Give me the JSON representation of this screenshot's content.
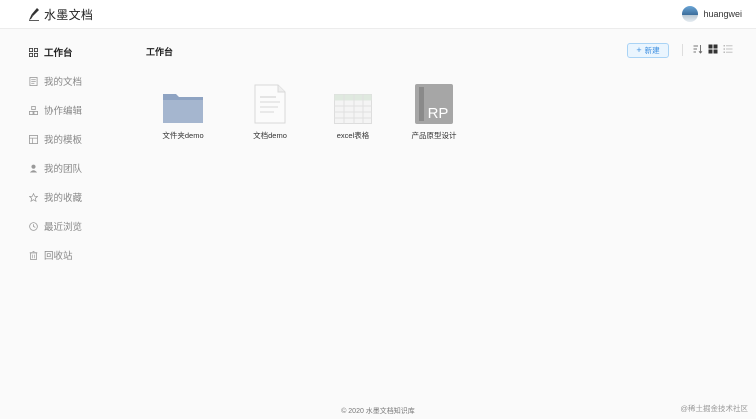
{
  "header": {
    "app_title": "水墨文档",
    "user_name": "huangwei"
  },
  "sidebar": {
    "items": [
      {
        "label": "工作台",
        "icon": "grid-icon",
        "active": true
      },
      {
        "label": "我的文档",
        "icon": "document-icon"
      },
      {
        "label": "协作编辑",
        "icon": "collaborate-icon"
      },
      {
        "label": "我的模板",
        "icon": "template-icon"
      },
      {
        "label": "我的团队",
        "icon": "team-icon"
      },
      {
        "label": "我的收藏",
        "icon": "star-icon"
      },
      {
        "label": "最近浏览",
        "icon": "clock-icon"
      },
      {
        "label": "回收站",
        "icon": "trash-icon"
      }
    ]
  },
  "main": {
    "title": "工作台",
    "new_button_label": "新建",
    "files": [
      {
        "label": "文件夹demo",
        "type": "folder"
      },
      {
        "label": "文档demo",
        "type": "document"
      },
      {
        "label": "excel表格",
        "type": "spreadsheet"
      },
      {
        "label": "产品原型设计",
        "type": "prototype",
        "badge": "RP"
      }
    ]
  },
  "footer": {
    "copyright": "© 2020 水墨文档知识库",
    "watermark": "@稀土掘金技术社区"
  },
  "colors": {
    "accent": "#3d8fe0",
    "folder": "#a5b6cf"
  }
}
